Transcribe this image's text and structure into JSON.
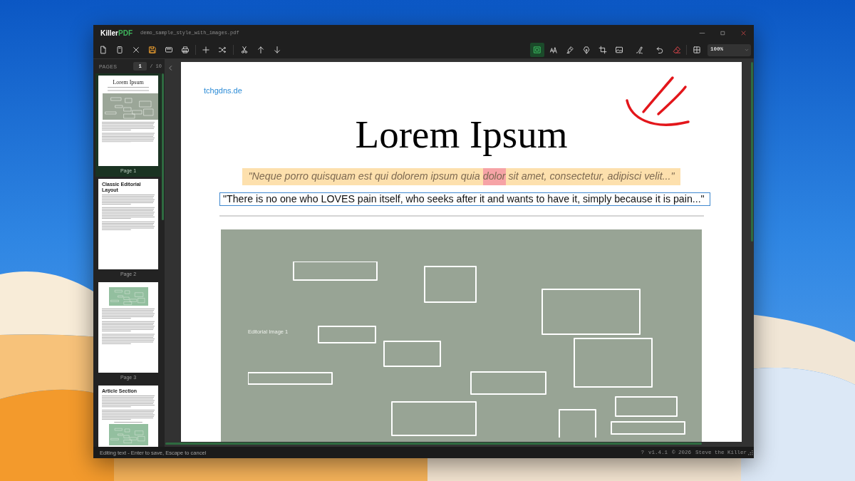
{
  "window": {
    "logo": "Killer",
    "logo_accent": "PDF",
    "title": "demo_sample_style_with_images.pdf"
  },
  "toolbar": {
    "unsaved_changes": true,
    "tools": [
      {
        "kind": "select",
        "selected": true
      },
      {
        "kind": "text",
        "selected": false
      },
      {
        "kind": "highlight",
        "selected": false
      },
      {
        "kind": "draw",
        "selected": false
      },
      {
        "kind": "crop",
        "selected": false
      },
      {
        "kind": "image",
        "selected": false
      },
      {
        "kind": "signature",
        "selected": false
      }
    ],
    "zoom": "100%"
  },
  "pages_panel": {
    "label": "PAGES",
    "current_page": "1",
    "total": "/ 10",
    "pages": [
      {
        "kind": "title-image",
        "label": "Page 1",
        "selected": true,
        "heading": "Lorem Ipsum"
      },
      {
        "kind": "heading-text",
        "label": "Page 2",
        "selected": false,
        "heading": "Classic Editorial Layout"
      },
      {
        "kind": "image-text",
        "label": "Page 3",
        "selected": false
      },
      {
        "kind": "heading-text-image",
        "selected": false,
        "heading": "Article Section"
      }
    ]
  },
  "document_page": {
    "link": "tchgdns.de",
    "title": "Lorem Ipsum",
    "quote": [
      {
        "text": "\"Neque porro quisquam est qui dolorem ipsum quia ",
        "highlighted": false
      },
      {
        "text": "dolor",
        "highlighted": true
      },
      {
        "text": " sit amet, consectetur, adipisci velit...\"",
        "highlighted": false
      }
    ],
    "editing_text": "\"There is no one who LOVES pain itself, who seeks after it and wants to have it, simply because it is pain...\"",
    "image_caption": "Editorial Image 1"
  },
  "status_bar": {
    "message": "Editing text - Enter to save, Escape to cancel",
    "help": "?",
    "version": "v1.4.1",
    "copyright": "© 2026",
    "author": "Steve the Killer"
  }
}
